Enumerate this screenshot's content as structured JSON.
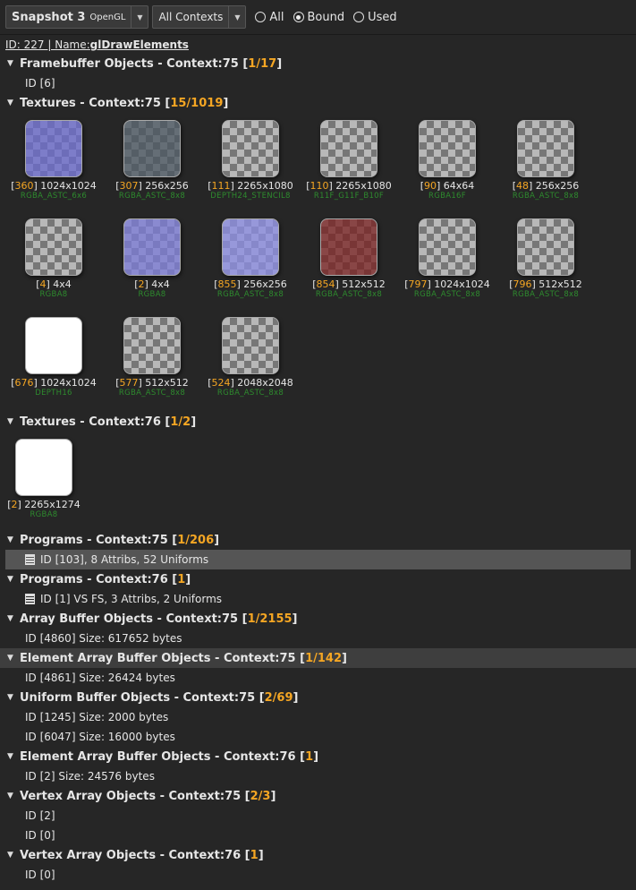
{
  "toolbar": {
    "snapshot_title": "Snapshot 3",
    "snapshot_api": "OpenGL",
    "contexts_label": "All Contexts",
    "filter_options": [
      {
        "label": "All",
        "selected": false
      },
      {
        "label": "Bound",
        "selected": true
      },
      {
        "label": "Used",
        "selected": false
      }
    ]
  },
  "call": {
    "prefix": "ID: 227 | Name: ",
    "name": "glDrawElements"
  },
  "sections": {
    "fbo": {
      "title": "Framebuffer Objects - Context:75 [",
      "count": "1/17",
      "items": [
        "ID [6]"
      ]
    },
    "tex75": {
      "title": "Textures - Context:75 [",
      "count": "15/1019",
      "items": [
        {
          "id": "360",
          "size": "1024x1024",
          "format": "RGBA_ASTC_6x6",
          "tint": "#6a6acf"
        },
        {
          "id": "307",
          "size": "256x256",
          "format": "RGBA_ASTC_8x8",
          "tint": "#4a5560"
        },
        {
          "id": "111",
          "size": "2265x1080",
          "format": "DEPTH24_STENCIL8",
          "tint": ""
        },
        {
          "id": "110",
          "size": "2265x1080",
          "format": "R11F_G11F_B10F",
          "tint": ""
        },
        {
          "id": "90",
          "size": "64x64",
          "format": "RGBA16F",
          "tint": ""
        },
        {
          "id": "48",
          "size": "256x256",
          "format": "RGBA_ASTC_8x8",
          "tint": ""
        },
        {
          "id": "4",
          "size": "4x4",
          "format": "RGBA8",
          "tint": ""
        },
        {
          "id": "2",
          "size": "4x4",
          "format": "RGBA8",
          "tint": "#7b7bd8"
        },
        {
          "id": "855",
          "size": "256x256",
          "format": "RGBA_ASTC_8x8",
          "tint": "#8c8ee6"
        },
        {
          "id": "854",
          "size": "512x512",
          "format": "RGBA_ASTC_8x8",
          "tint": "#7a2020"
        },
        {
          "id": "797",
          "size": "1024x1024",
          "format": "RGBA_ASTC_8x8",
          "tint": ""
        },
        {
          "id": "796",
          "size": "512x512",
          "format": "RGBA_ASTC_8x8",
          "tint": ""
        },
        {
          "id": "676",
          "size": "1024x1024",
          "format": "DEPTH16",
          "tint": "#ffffff"
        },
        {
          "id": "577",
          "size": "512x512",
          "format": "RGBA_ASTC_8x8",
          "tint": ""
        },
        {
          "id": "524",
          "size": "2048x2048",
          "format": "RGBA_ASTC_8x8",
          "tint": ""
        }
      ]
    },
    "tex76": {
      "title": "Textures - Context:76 [",
      "count": "1/2",
      "items": [
        {
          "id": "2",
          "size": "2265x1274",
          "format": "RGBA8",
          "tint": "#ffffff"
        }
      ]
    },
    "prog75": {
      "title": "Programs - Context:75 [",
      "count": "1/206",
      "items": [
        "ID [103], 8 Attribs, 52 Uniforms"
      ]
    },
    "prog76": {
      "title": "Programs - Context:76 [",
      "count": "1",
      "items": [
        "ID [1] VS FS, 3 Attribs, 2 Uniforms"
      ]
    },
    "abo75": {
      "title": "Array Buffer Objects - Context:75 [",
      "count": "1/2155",
      "items": [
        "ID [4860] Size: 617652 bytes"
      ]
    },
    "ebo75": {
      "title": "Element Array Buffer Objects - Context:75 [",
      "count": "1/142",
      "items": [
        "ID [4861] Size: 26424 bytes"
      ]
    },
    "ubo75": {
      "title": "Uniform Buffer Objects - Context:75 [",
      "count": "2/69",
      "items": [
        "ID [1245] Size: 2000 bytes",
        "ID [6047] Size: 16000 bytes"
      ]
    },
    "ebo76": {
      "title": "Element Array Buffer Objects - Context:76 [",
      "count": "1",
      "items": [
        "ID [2] Size: 24576 bytes"
      ]
    },
    "vao75": {
      "title": "Vertex Array Objects - Context:75 [",
      "count": "2/3",
      "items": [
        "ID [2]",
        "ID [0]"
      ]
    },
    "vao76": {
      "title": "Vertex Array Objects - Context:76 [",
      "count": "1",
      "items": [
        "ID [0]"
      ]
    }
  },
  "colors": {
    "accent": "#f5a623",
    "format_green": "#2e8b2e",
    "background": "#262626"
  }
}
